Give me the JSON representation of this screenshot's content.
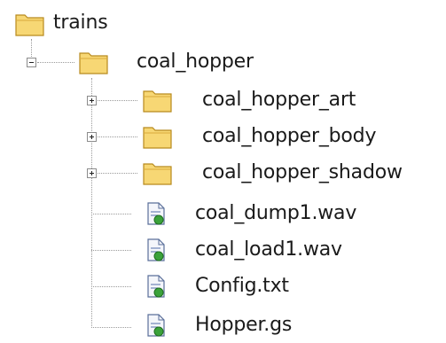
{
  "tree": {
    "root": {
      "label": "trains",
      "icon": "folder-icon",
      "expanded": true
    },
    "child": {
      "label": "coal_hopper",
      "icon": "folder-icon",
      "expanded": true,
      "items": [
        {
          "label": "coal_hopper_art",
          "type": "folder",
          "icon": "folder-icon",
          "expanded": false
        },
        {
          "label": "coal_hopper_body",
          "type": "folder",
          "icon": "folder-icon",
          "expanded": false
        },
        {
          "label": "coal_hopper_shadow",
          "type": "folder",
          "icon": "folder-icon",
          "expanded": false
        },
        {
          "label": "coal_dump1.wav",
          "type": "file",
          "icon": "file-icon"
        },
        {
          "label": "coal_load1.wav",
          "type": "file",
          "icon": "file-icon"
        },
        {
          "label": "Config.txt",
          "type": "file",
          "icon": "file-icon"
        },
        {
          "label": "Hopper.gs",
          "type": "file",
          "icon": "file-icon"
        }
      ]
    },
    "colors": {
      "folder_body": "#f7d774",
      "folder_shade": "#d9a93a",
      "folder_outline": "#b88a1e",
      "file_paper": "#f4f6fb",
      "file_outline": "#5a6f9a",
      "file_lines": "#6f86b8",
      "file_badge": "#3aa23a",
      "tree_lines": "#9a9a9a"
    }
  }
}
